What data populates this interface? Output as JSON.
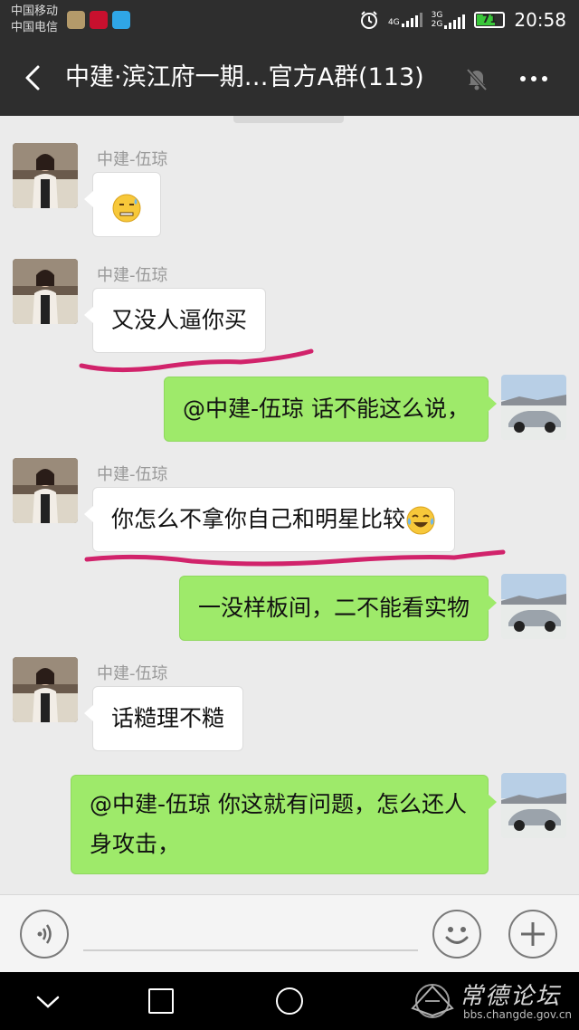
{
  "status_bar": {
    "carrier_1": "中国移动",
    "carrier_2": "中国电信",
    "net_1_top": "4G",
    "net_2_top": "3G",
    "net_2_bottom": "2G",
    "battery_level": "71",
    "time": "20:58"
  },
  "title_bar": {
    "title": "中建·滨江府一期…官方A群(113)"
  },
  "messages": [
    {
      "sender": "中建-伍琼",
      "text": ""
    },
    {
      "sender": "中建-伍琼",
      "text": "又没人逼你买"
    },
    {
      "text": "@中建-伍琼  话不能这么说，"
    },
    {
      "sender": "中建-伍琼",
      "text": "你怎么不拿你自己和明星比较"
    },
    {
      "text": "一没样板间，二不能看实物"
    },
    {
      "sender": "中建-伍琼",
      "text": "话糙理不糙"
    },
    {
      "text": "@中建-伍琼  你这就有问题，怎么还人身攻击，"
    }
  ],
  "icons": {
    "emoji_1": "grimace-sweat-emoji-icon",
    "emoji_2": "laugh-cry-emoji-icon"
  },
  "colors": {
    "outgoing_bubble": "#9eea6a",
    "incoming_bubble": "#ffffff",
    "annotation_line": "#d1236b",
    "bar_background": "#2e2e2e"
  },
  "watermark": {
    "name": "常德论坛",
    "url": "bbs.changde.gov.cn"
  }
}
